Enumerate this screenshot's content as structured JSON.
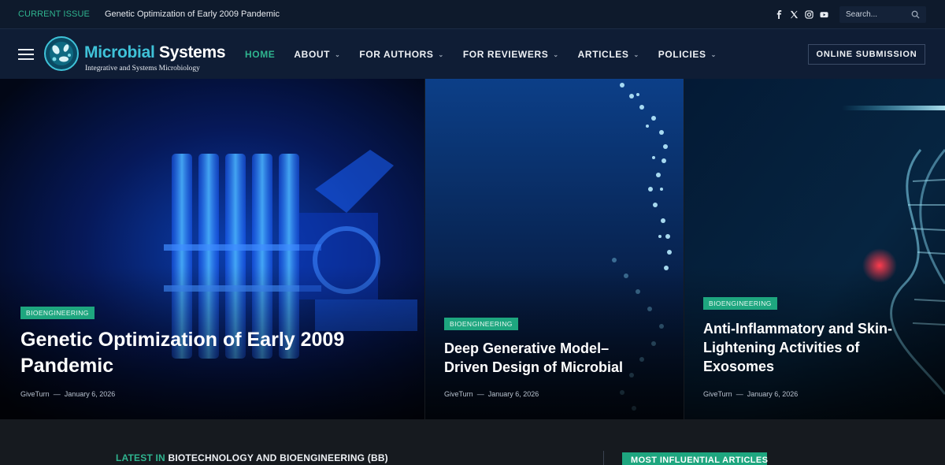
{
  "topbar": {
    "current_issue_label": "CURRENT ISSUE",
    "current_issue_title": "Genetic Optimization of Early 2009 Pandemic",
    "socials": [
      "facebook-icon",
      "x-icon",
      "instagram-icon",
      "youtube-icon"
    ],
    "search_placeholder": "Search..."
  },
  "logo": {
    "title_part1": "Microbial",
    "title_part2": " Systems",
    "subtitle": "Integrative and Systems Microbiology"
  },
  "nav": {
    "items": [
      {
        "label": "HOME",
        "dropdown": false
      },
      {
        "label": "ABOUT",
        "dropdown": true
      },
      {
        "label": "FOR AUTHORS",
        "dropdown": true
      },
      {
        "label": "FOR REVIEWERS",
        "dropdown": true
      },
      {
        "label": "ARTICLES",
        "dropdown": true
      },
      {
        "label": "POLICIES",
        "dropdown": true
      }
    ],
    "submit_label": "ONLINE SUBMISSION"
  },
  "hero": [
    {
      "category": "BIOENGINEERING",
      "title": "Genetic Optimization of Early 2009 Pandemic",
      "author": "GiveTurn",
      "date": "January 6, 2026"
    },
    {
      "category": "BIOENGINEERING",
      "title": "Deep Generative Model–Driven Design of Microbial",
      "author": "GiveTurn",
      "date": "January 6, 2026"
    },
    {
      "category": "BIOENGINEERING",
      "title": "Anti-Inflammatory and Skin-Lightening Activities of Exosomes",
      "author": "GiveTurn",
      "date": "January 6, 2026"
    }
  ],
  "bottom": {
    "latest_prefix": "LATEST IN",
    "latest_section": "BIOTECHNOLOGY AND BIOENGINEERING (BB)",
    "most_influential_label": "MOST INFLUENTIAL ARTICLES"
  },
  "colors": {
    "accent": "#2fb48f",
    "badge": "#1ea67f",
    "nav_bg": "#0f1d35",
    "topbar_bg": "#0e1a2c"
  }
}
